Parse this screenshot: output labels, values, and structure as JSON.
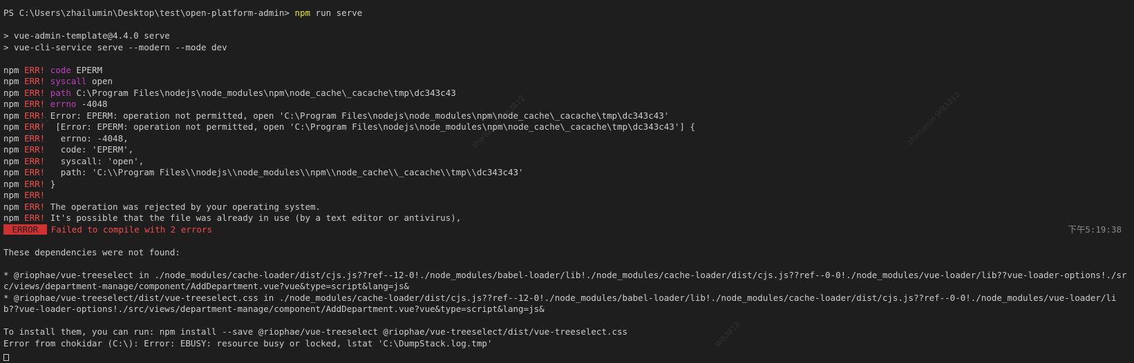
{
  "prompt": {
    "path": "PS C:\\Users\\zhailumin\\Desktop\\test\\open-platform-admin> ",
    "cmd": "npm",
    "args": " run serve"
  },
  "script_lines": [
    "> vue-admin-template@4.4.0 serve",
    "> vue-cli-service serve --modern --mode dev"
  ],
  "npm": {
    "prefix": "npm ",
    "err": "ERR!"
  },
  "npm_err_lines": [
    {
      "key": "code",
      "rest": " EPERM"
    },
    {
      "key": "syscall",
      "rest": " open"
    },
    {
      "key": "path",
      "rest": " C:\\Program Files\\nodejs\\node_modules\\npm\\node_cache\\_cacache\\tmp\\dc343c43"
    },
    {
      "key": "errno",
      "rest": " -4048"
    },
    {
      "key": "",
      "rest": " Error: EPERM: operation not permitted, open 'C:\\Program Files\\nodejs\\node_modules\\npm\\node_cache\\_cacache\\tmp\\dc343c43'"
    },
    {
      "key": "",
      "rest": "  [Error: EPERM: operation not permitted, open 'C:\\Program Files\\nodejs\\node_modules\\npm\\node_cache\\_cacache\\tmp\\dc343c43'] {"
    },
    {
      "key": "",
      "rest": "   errno: -4048,"
    },
    {
      "key": "",
      "rest": "   code: 'EPERM',"
    },
    {
      "key": "",
      "rest": "   syscall: 'open',"
    },
    {
      "key": "",
      "rest": "   path: 'C:\\\\Program Files\\\\nodejs\\\\node_modules\\\\npm\\\\node_cache\\\\_cacache\\\\tmp\\\\dc343c43'"
    },
    {
      "key": "",
      "rest": " }"
    },
    {
      "key": "",
      "rest": ""
    },
    {
      "key": "",
      "rest": " The operation was rejected by your operating system."
    },
    {
      "key": "",
      "rest": " It's possible that the file was already in use (by a text editor or antivirus),"
    }
  ],
  "compile_error": {
    "badge": " ERROR ",
    "message": "Failed to compile with 2 errors",
    "timestamp": "下午5:19:38"
  },
  "deps_header": "These dependencies were not found:",
  "deps": [
    "* @riophae/vue-treeselect in ./node_modules/cache-loader/dist/cjs.js??ref--12-0!./node_modules/babel-loader/lib!./node_modules/cache-loader/dist/cjs.js??ref--0-0!./node_modules/vue-loader/lib??vue-loader-options!./src/views/department-manage/component/AddDepartment.vue?vue&type=script&lang=js&",
    "* @riophae/vue-treeselect/dist/vue-treeselect.css in ./node_modules/cache-loader/dist/cjs.js??ref--12-0!./node_modules/babel-loader/lib!./node_modules/cache-loader/dist/cjs.js??ref--0-0!./node_modules/vue-loader/lib??vue-loader-options!./src/views/department-manage/component/AddDepartment.vue?vue&type=script&lang=js&"
  ],
  "install_hint": "To install them, you can run: npm install --save @riophae/vue-treeselect @riophae/vue-treeselect/dist/vue-treeselect.css",
  "chokidar_error": "Error from chokidar (C:\\): Error: EBUSY: resource busy or locked, lstat 'C:\\DumpStack.log.tmp'",
  "watermarks": [
    {
      "text": "zhailumin W83812"
    },
    {
      "text": "zhailumin W83812"
    },
    {
      "text": "W83812"
    },
    {
      "text": "W83812"
    }
  ]
}
